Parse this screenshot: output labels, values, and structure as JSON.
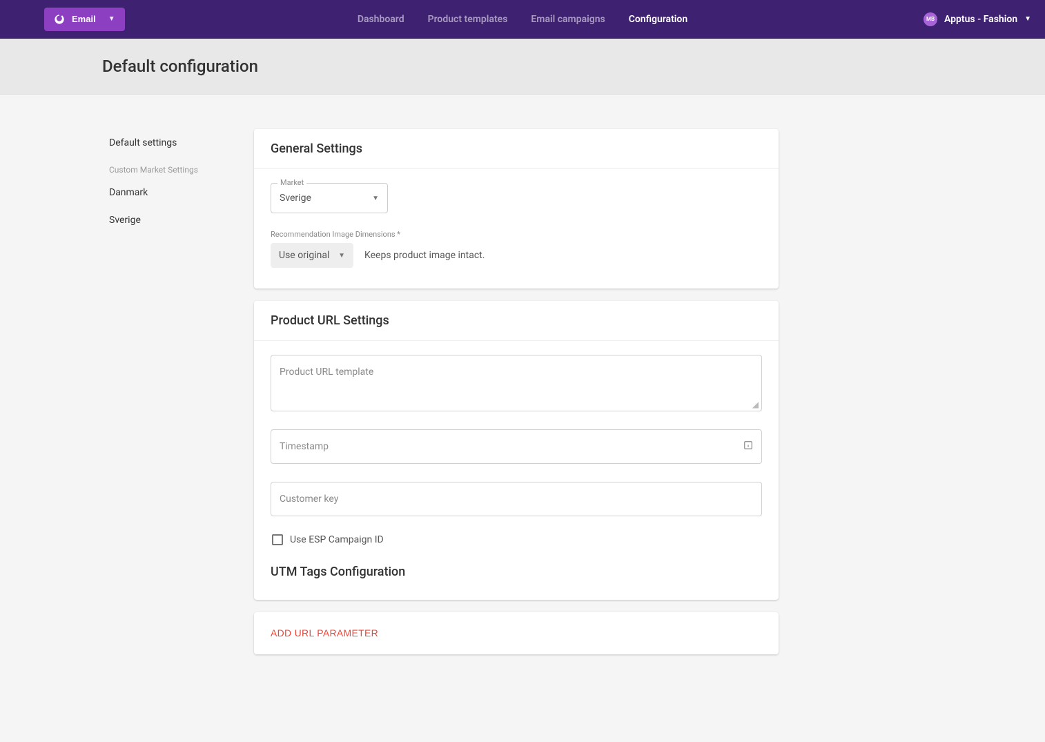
{
  "topbar": {
    "brand_label": "Email",
    "nav": {
      "dashboard": "Dashboard",
      "product_templates": "Product templates",
      "email_campaigns": "Email campaigns",
      "configuration": "Configuration"
    },
    "avatar_initials": "MB",
    "account_name": "Apptus - Fashion"
  },
  "page_title": "Default configuration",
  "sidebar": {
    "default_settings": "Default settings",
    "category_label": "Custom Market Settings",
    "items": [
      "Danmark",
      "Sverige"
    ]
  },
  "general_settings": {
    "title": "General Settings",
    "market_label": "Market",
    "market_value": "Sverige",
    "image_dim_label": "Recommendation Image Dimensions *",
    "image_dim_value": "Use original",
    "image_dim_hint": "Keeps product image intact."
  },
  "product_url_settings": {
    "title": "Product URL Settings",
    "url_template_placeholder": "Product URL template",
    "timestamp_placeholder": "Timestamp",
    "customer_key_placeholder": "Customer key",
    "use_esp_label": "Use ESP Campaign ID",
    "utm_title": "UTM Tags Configuration",
    "add_param_label": "ADD URL PARAMETER"
  }
}
